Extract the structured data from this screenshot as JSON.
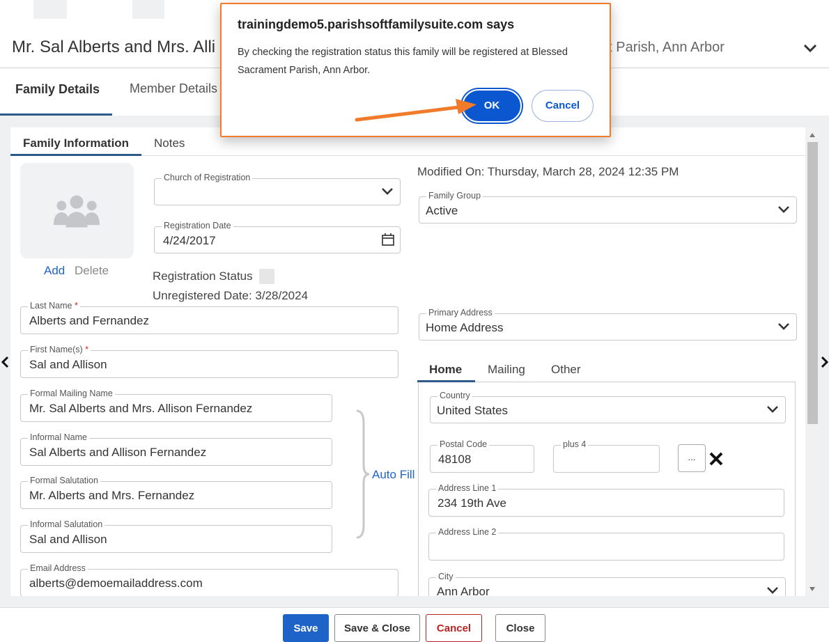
{
  "header": {
    "title": "Mr. Sal Alberts and Mrs. Alli",
    "title_right": "nt Parish, Ann Arbor"
  },
  "main_tabs": [
    {
      "label": "Family Details",
      "active": true
    },
    {
      "label": "Member Details",
      "active": false
    }
  ],
  "subtabs": [
    {
      "label": "Family Information",
      "active": true
    },
    {
      "label": "Notes",
      "active": false
    }
  ],
  "photo": {
    "add_label": "Add",
    "delete_label": "Delete"
  },
  "left_top": {
    "church_label": "Church of Registration",
    "church_value": "",
    "reg_date_label": "Registration Date",
    "reg_date_value": "4/24/2017",
    "reg_status_label": "Registration Status",
    "unregistered_text": "Unregistered Date: 3/28/2024"
  },
  "right_top": {
    "modified_text": "Modified On: Thursday, March 28, 2024 12:35 PM",
    "family_group_label": "Family Group",
    "family_group_value": "Active",
    "primary_address_label": "Primary Address",
    "primary_address_value": "Home Address"
  },
  "names": {
    "last_name_label": "Last Name",
    "last_name_value": "Alberts and Fernandez",
    "first_name_label": "First Name(s)",
    "first_name_value": "Sal and Allison",
    "formal_mailing_label": "Formal Mailing Name",
    "formal_mailing_value": "Mr. Sal Alberts and Mrs. Allison Fernandez",
    "informal_name_label": "Informal Name",
    "informal_name_value": "Sal Alberts and Allison Fernandez",
    "formal_salutation_label": "Formal Salutation",
    "formal_salutation_value": "Mr. Alberts and Mrs. Fernandez",
    "informal_salutation_label": "Informal Salutation",
    "informal_salutation_value": "Sal and Allison",
    "email_label": "Email Address",
    "email_value": "alberts@demoemailaddress.com",
    "required_mark": "*",
    "auto_fill_label": "Auto Fill"
  },
  "address_tabs": [
    {
      "label": "Home",
      "active": true
    },
    {
      "label": "Mailing",
      "active": false
    },
    {
      "label": "Other",
      "active": false
    }
  ],
  "address": {
    "country_label": "Country",
    "country_value": "United States",
    "postal_label": "Postal Code",
    "postal_value": "48108",
    "plus4_label": "plus 4",
    "plus4_value": "",
    "lookup_label": "...",
    "line1_label": "Address Line 1",
    "line1_value": "234 19th Ave",
    "line2_label": "Address Line 2",
    "line2_value": "",
    "city_label": "City",
    "city_value": "Ann Arbor"
  },
  "footer": {
    "save": "Save",
    "save_close": "Save & Close",
    "cancel": "Cancel",
    "close": "Close"
  },
  "dialog": {
    "title": "trainingdemo5.parishsoftfamilysuite.com says",
    "message": "By checking the registration status this family will be registered at Blessed Sacrament Parish, Ann Arbor.",
    "ok": "OK",
    "cancel": "Cancel"
  },
  "colors": {
    "accent": "#2d5a8a",
    "link": "#1e64c8",
    "dialog_border": "#f07b2b",
    "danger": "#b22222"
  }
}
